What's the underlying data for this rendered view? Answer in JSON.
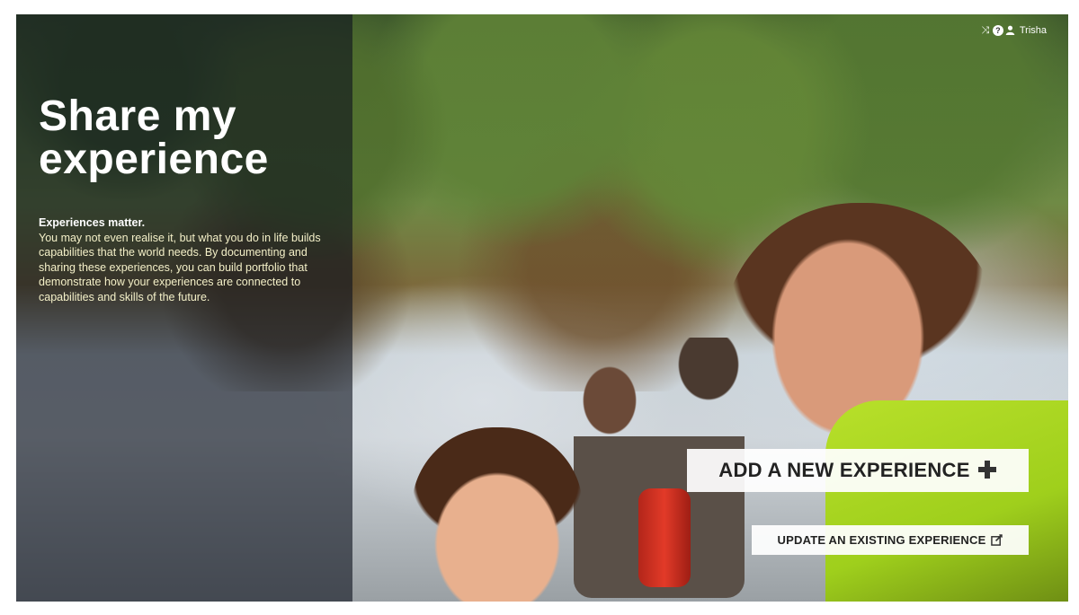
{
  "hero": {
    "title": "Share my experience",
    "intro_heading": "Experiences matter.",
    "intro_body": "You may not even realise it, but what you do in life builds capabilities that the world needs. By documenting and sharing these experiences, you can build portfolio that demonstrate how your experiences are connected to capabilities and skills of the future."
  },
  "user_bar": {
    "icons": [
      "shuffle-icon",
      "help-icon",
      "user-icon"
    ],
    "user_name": "Trisha"
  },
  "actions": {
    "add_label": "ADD A NEW EXPERIENCE",
    "add_icon": "plus-icon",
    "update_label": "UPDATE AN EXISTING EXPERIENCE",
    "update_icon": "edit-icon"
  },
  "colors": {
    "panel_overlay": "#0f141e",
    "intro_text": "#f4f0c8",
    "button_bg": "#ffffff",
    "button_text": "#222222"
  }
}
